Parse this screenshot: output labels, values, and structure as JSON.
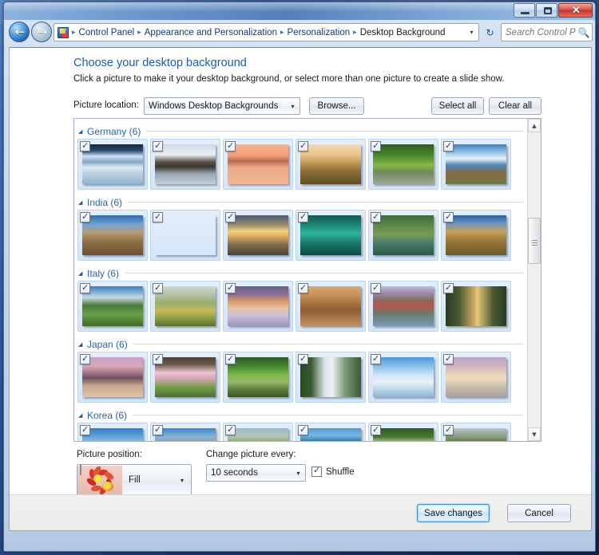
{
  "window": {
    "controls": {
      "minimize": "minimize-button",
      "maximize": "maximize-button",
      "close_glyph": "✕"
    }
  },
  "navigation": {
    "back_glyph": "←",
    "forward_glyph": "→",
    "history_caret": "▾",
    "breadcrumbs": [
      "Control Panel",
      "Appearance and Personalization",
      "Personalization",
      "Desktop Background"
    ],
    "breadcrumb_separator": "▸",
    "address_caret": "▾",
    "refresh_glyph": "↻",
    "search": {
      "placeholder": "Search Control Panel",
      "value": "",
      "icon": "🔍"
    }
  },
  "page": {
    "title": "Choose your desktop background",
    "subtitle": "Click a picture to make it your desktop background, or select more than one picture to create a slide show."
  },
  "location_row": {
    "label": "Picture location:",
    "selected": "Windows Desktop Backgrounds",
    "caret": "▾",
    "browse_label": "Browse...",
    "select_all_label": "Select all",
    "clear_all_label": "Clear all"
  },
  "groups": [
    {
      "name": "Germany (6)",
      "triangle": "◢",
      "items": [
        {
          "checked": true,
          "alt": "alpine-lake-with-snowy-peaks"
        },
        {
          "checked": true,
          "alt": "frosted-boathouse-reflection"
        },
        {
          "checked": true,
          "alt": "orange-sunset-lake-pilings"
        },
        {
          "checked": true,
          "alt": "golden-meadow-hay-bales"
        },
        {
          "checked": true,
          "alt": "tree-lined-country-road"
        },
        {
          "checked": true,
          "alt": "blue-mountain-lake-shoreline"
        }
      ]
    },
    {
      "name": "India (6)",
      "triangle": "◢",
      "items": [
        {
          "checked": true,
          "alt": "sandstone-fort-tower"
        },
        {
          "checked": true,
          "alt": "golden-palace-waterfront"
        },
        {
          "checked": true,
          "alt": "sunrise-sea-with-lantern"
        },
        {
          "checked": true,
          "alt": "peacock-feather-closeup"
        },
        {
          "checked": true,
          "alt": "peacock-displaying-plumage"
        },
        {
          "checked": true,
          "alt": "desert-city-lake-reflection"
        }
      ]
    },
    {
      "name": "Italy (6)",
      "triangle": "◢",
      "items": [
        {
          "checked": true,
          "alt": "dolomites-green-valley"
        },
        {
          "checked": true,
          "alt": "tuscan-rolling-hills"
        },
        {
          "checked": true,
          "alt": "snowy-dolomite-cliffs-at-dusk"
        },
        {
          "checked": true,
          "alt": "stone-arch-bridge-reflection"
        },
        {
          "checked": true,
          "alt": "cliffside-village-by-sea"
        },
        {
          "checked": true,
          "alt": "cypress-avenue-at-sunset"
        }
      ]
    },
    {
      "name": "Japan (6)",
      "triangle": "◢",
      "items": [
        {
          "checked": true,
          "alt": "torii-gate-purple-dusk"
        },
        {
          "checked": true,
          "alt": "blossoming-cherry-tree"
        },
        {
          "checked": true,
          "alt": "mossy-forest-stream"
        },
        {
          "checked": true,
          "alt": "tall-waterfall-curtain"
        },
        {
          "checked": true,
          "alt": "blue-ice-formations"
        },
        {
          "checked": true,
          "alt": "frosted-trees-winter-sunrise"
        }
      ]
    },
    {
      "name": "Korea (6)",
      "triangle": "◢",
      "items": [
        {
          "checked": true,
          "alt": "yellow-canola-field-island"
        },
        {
          "checked": true,
          "alt": "traditional-gate-city-tulips"
        },
        {
          "checked": true,
          "alt": "red-bridge-over-pond"
        },
        {
          "checked": true,
          "alt": "volcanic-coast-blue-sea"
        },
        {
          "checked": true,
          "alt": "cascading-forest-waterfall"
        },
        {
          "checked": true,
          "alt": "green-crater-meadow"
        }
      ]
    }
  ],
  "scrollbar": {
    "up_glyph": "▲",
    "down_glyph": "▼"
  },
  "picture_position": {
    "label": "Picture position:",
    "selected": "Fill",
    "caret": "▾",
    "preview_icon": "flower-wallpaper-thumbnail"
  },
  "change_every": {
    "label": "Change picture every:",
    "selected": "10 seconds",
    "caret": "▾"
  },
  "shuffle": {
    "label": "Shuffle",
    "checked": true
  },
  "footer": {
    "save_label": "Save changes",
    "cancel_label": "Cancel"
  },
  "colors": {
    "accent_link": "#1d5bb5",
    "group_heading": "#2d62a8",
    "checkmark": "#1e3e8c",
    "default_button_border": "#4a8fc4"
  }
}
